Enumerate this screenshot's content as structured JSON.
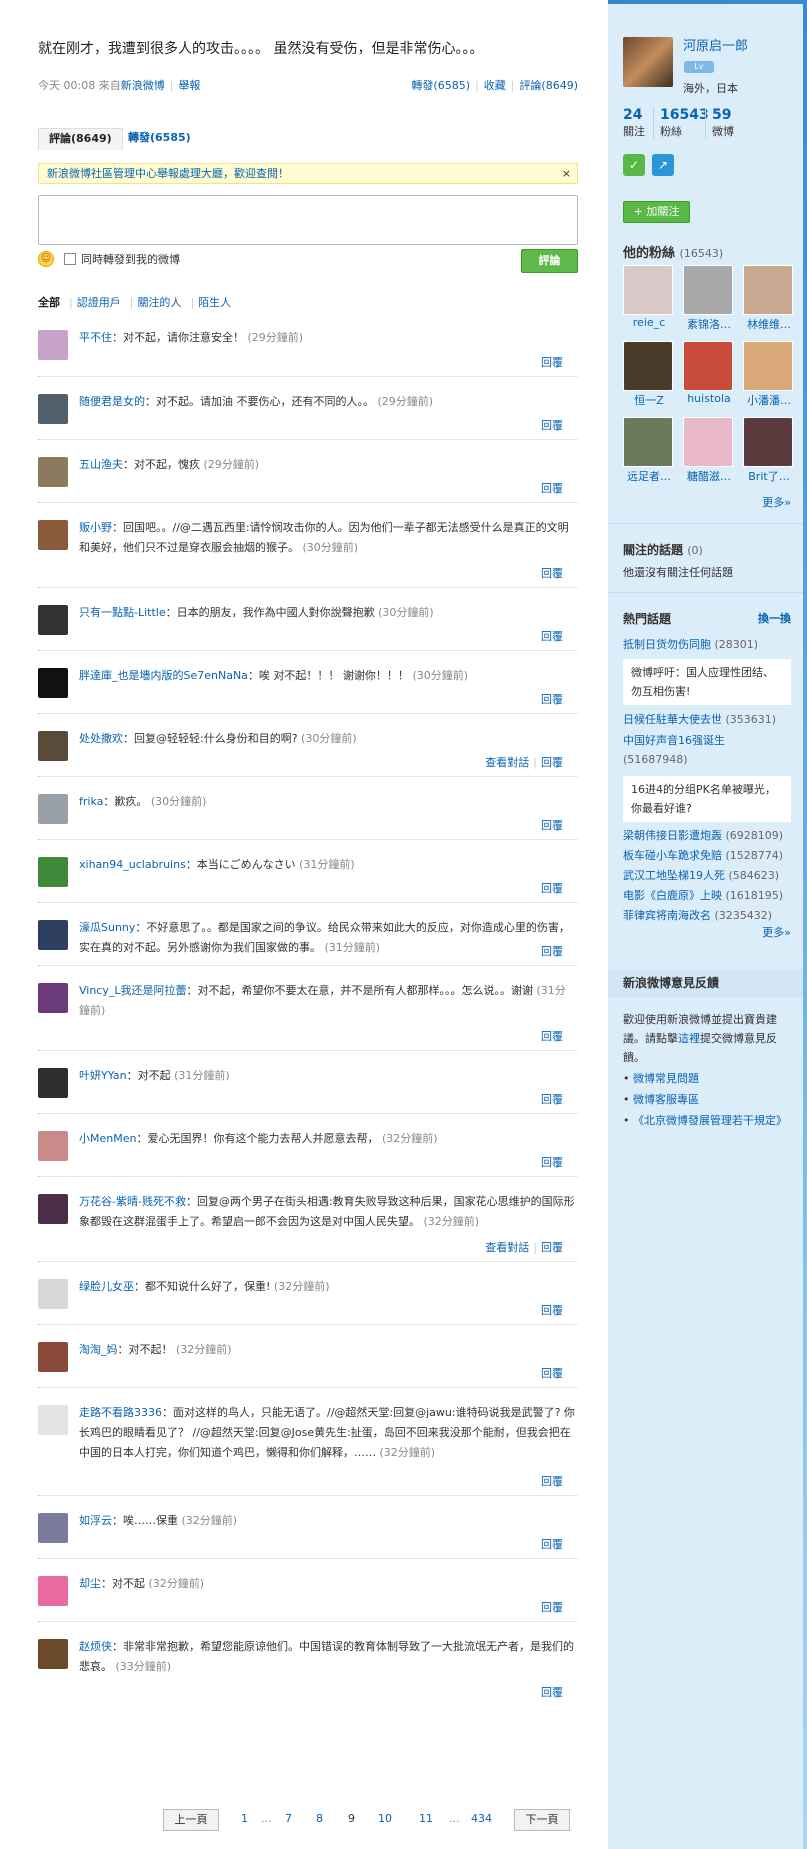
{
  "post": {
    "text": "就在刚才，我遭到很多人的攻击。。。。 虽然没有受伤，但是非常伤心。。。",
    "time": "今天 00:08 來自",
    "source": "新浪微博",
    "report": "舉報",
    "repost": "轉發(6585)",
    "fav": "收藏",
    "comment": "評論(8649)"
  },
  "tabs": {
    "comments": "評論(8649)",
    "reposts": "轉發(6585)"
  },
  "notice": {
    "text": "新浪微博社區管理中心舉報處理大廳，歡迎查閱！",
    "close": "×"
  },
  "compose": {
    "sync_label": "同時轉發到我的微博",
    "send": "評論"
  },
  "filters": {
    "all": "全部",
    "verified": "認證用戶",
    "following": "關注的人",
    "strangers": "陌生人"
  },
  "comments": [
    {
      "name": "平不住",
      "text": "：对不起，请你注意安全！",
      "time": "(29分鐘前)",
      "reply": "回覆",
      "avatar": "#c7a2c9"
    },
    {
      "name": "随便君是女的",
      "text": "：对不起。请加油 不要伤心，还有不同的人。。",
      "time": "(29分鐘前)",
      "reply": "回覆",
      "avatar": "#50606c"
    },
    {
      "name": "五山渔夫",
      "text": "：对不起，愧疚",
      "time": "(29分鐘前)",
      "reply": "回覆",
      "avatar": "#8c7a5e"
    },
    {
      "name": "贩小野",
      "text": "：回国吧。。//@二遇瓦西里:请怜悯攻击你的人。因为他们一辈子都无法感受什么是真正的文明和美好，他们只不过是穿衣服会抽烟的猴子。",
      "time": "(30分鐘前)",
      "reply": "回覆",
      "avatar": "#8a5a3a"
    },
    {
      "name": "只有一點點-Little",
      "text": "：日本的朋友，我作為中國人對你說聲抱歉",
      "time": "(30分鐘前)",
      "reply": "回覆",
      "avatar": "#333333"
    },
    {
      "name": "胖達庫_也是墻内版的Se7enNaNa",
      "text": "：唉 对不起！！！ 谢谢你！！！",
      "time": "(30分鐘前)",
      "reply": "回覆",
      "avatar": "#111111"
    },
    {
      "name": "处处撒欢",
      "text": "：回复@轻轻轻:什么身份和目的啊?",
      "time": "(30分鐘前)",
      "reply": "回覆",
      "extra": "查看對話",
      "avatar": "#5a4a3a"
    },
    {
      "name": "frika",
      "text": "：歉疚。",
      "time": "(30分鐘前)",
      "reply": "回覆",
      "avatar": "#9aa0a8"
    },
    {
      "name": "xihan94_uclabruins",
      "text": "：本当にごめんなさい",
      "time": "(31分鐘前)",
      "reply": "回覆",
      "avatar": "#3e8a3a"
    },
    {
      "name": "濠瓜Sunny",
      "text": "：不好意思了。。都是国家之间的争议。给民众带来如此大的反应，对你造成心里的伤害，实在真的对不起。另外感谢你为我们国家做的事。",
      "time": "(31分鐘前)",
      "reply": "回覆",
      "avatar": "#2e3e5e"
    },
    {
      "name": "Vincy_L我还是阿拉蕾",
      "text": "：对不起，希望你不要太在意，并不是所有人都那样。。。怎么说。。谢谢",
      "time": "(31分鐘前)",
      "reply": "回覆",
      "avatar": "#6a3a7a"
    },
    {
      "name": "叶妍YYan",
      "text": "：对不起",
      "time": "(31分鐘前)",
      "reply": "回覆",
      "avatar": "#2e2e2e"
    },
    {
      "name": "小MenMen",
      "text": "：爱心无国界！你有这个能力去帮人并愿意去帮，",
      "time": "(32分鐘前)",
      "reply": "回覆",
      "avatar": "#c98a8a"
    },
    {
      "name": "万花谷-紫晴-贱死不救",
      "text": "：回复@两个男子在街头相遇:教育失败导致这种后果，国家花心思维护的国际形象都毁在这群混蛋手上了。希望启一郎不会因为这是对中国人民失望。",
      "time": "(32分鐘前)",
      "reply": "回覆",
      "extra": "查看對話",
      "avatar": "#4a2e4a"
    },
    {
      "name": "绿脸儿女巫",
      "text": "：都不知说什么好了，保重!",
      "time": "(32分鐘前)",
      "reply": "回覆",
      "avatar": "#d8d8d8"
    },
    {
      "name": "淘淘_妈",
      "text": "：对不起！",
      "time": "(32分鐘前)",
      "reply": "回覆",
      "avatar": "#8a4a3a"
    },
    {
      "name": "走路不看路3336",
      "text": "：面对这样的鸟人，只能无语了。//@超然天堂:回复@jawu:谁特码说我是武警了? 你长鸡巴的眼睛看见了？ //@超然天堂:回复@Jose黄先生:扯蛋，岛回不回来我没那个能耐，但我会把在中国的日本人打完，你们知道个鸡巴，懒得和你们解释，……",
      "time": "(32分鐘前)",
      "reply": "回覆",
      "avatar": "#e4e4e4"
    },
    {
      "name": "如浮云",
      "text": "：唉……保重",
      "time": "(32分鐘前)",
      "reply": "回覆",
      "avatar": "#7a7a9a"
    },
    {
      "name": "却尘",
      "text": "：对不起",
      "time": "(32分鐘前)",
      "reply": "回覆",
      "avatar": "#e86aa0"
    },
    {
      "name": "赵烦侠",
      "text": "：非常非常抱歉，希望您能原谅他们。中国错误的教育体制导致了一大批流氓无产者，是我们的悲哀。",
      "time": "(33分鐘前)",
      "reply": "回覆",
      "avatar": "#6a4a2a"
    }
  ],
  "pager": {
    "prev": "上一頁",
    "next": "下一頁",
    "p1": "1",
    "dots": "...",
    "p7": "7",
    "p8": "8",
    "p9": "9",
    "p10": "10",
    "p11": "11",
    "p434": "434"
  },
  "profile": {
    "name": "河原启一郎",
    "badge": "Lv",
    "location": "海外，日本",
    "following_n": "24",
    "following_l": "關注",
    "fans_n": "16543",
    "fans_l": "粉絲",
    "weibo_n": "59",
    "weibo_l": "微博",
    "follow_btn": "+ 加關注"
  },
  "fans": {
    "title": "他的粉絲",
    "count": "(16543)",
    "more": "更多»",
    "items": [
      {
        "name": "reie_c",
        "color": "#d8c8c8"
      },
      {
        "name": "素锦洛…",
        "color": "#a8a8a8"
      },
      {
        "name": "林维维…",
        "color": "#c8a890"
      },
      {
        "name": "恒一Z",
        "color": "#4a3a2a"
      },
      {
        "name": "huistola",
        "color": "#c84a3a"
      },
      {
        "name": "小潘潘…",
        "color": "#d8a878"
      },
      {
        "name": "远足者…",
        "color": "#6a7a5a"
      },
      {
        "name": "糖醋滋…",
        "color": "#e8b8c8"
      },
      {
        "name": "Brit了…",
        "color": "#5a3a3a"
      }
    ]
  },
  "topics": {
    "title": "關注的話題",
    "count": "(0)",
    "empty": "他還沒有關注任何話題"
  },
  "hot": {
    "title": "熱門話題",
    "refresh": "換一換",
    "more": "更多»",
    "t1": "抵制日货勿伤同胞",
    "c1": "(28301)",
    "box1": "微博呼吁：国人应理性团结、勿互相伤害!",
    "t2": "日候任駐華大使去世",
    "c2": "(353631)",
    "t3": "中国好声音16强诞生",
    "c3": "(51687948)",
    "box2": "16进4的分组PK名单被曝光，你最看好谁?",
    "t4": "梁朝伟接日影遭炮轰",
    "c4": "(6928109)",
    "t5": "板车碰小车跪求免赔",
    "c5": "(1528774)",
    "t6": "武汉工地坠梯19人死",
    "c6": "(584623)",
    "t7": "电影《白鹿原》上映",
    "c7": "(1618195)",
    "t8": "菲律宾将南海改名",
    "c8": "(3235432)"
  },
  "feedback": {
    "title": "新浪微博意見反饋",
    "text1": "歡迎使用新浪微博並提出寶貴建議。請點擊",
    "link": "這裡",
    "text2": "提交微博意見反饋。",
    "l1": "微博常見問題",
    "l2": "微博客服專區",
    "l3": "《北京微博發展管理若干規定》"
  }
}
